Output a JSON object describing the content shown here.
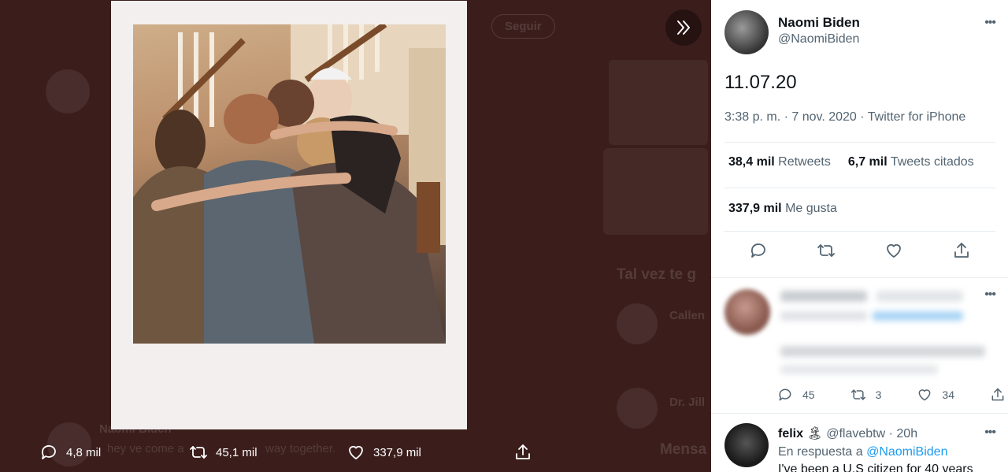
{
  "media_view": {
    "background_text": {
      "follow_button": "Seguir",
      "suggestions_heading": "Tal vez te g",
      "suggestion_1": "Callen",
      "suggestion_2": "Dr. Jill",
      "messages_label": "Mensa",
      "bg_author": "Naomi Biden",
      "bg_tweet_text": "hey ve come a",
      "bg_tweet_text_2": "way together."
    },
    "actions": {
      "replies": "4,8 mil",
      "retweets": "45,1 mil",
      "likes": "337,9 mil"
    }
  },
  "tweet": {
    "author_name": "Naomi Biden",
    "author_handle": "@NaomiBiden",
    "text": "11.07.20",
    "time": "3:38 p. m.",
    "date": "7 nov. 2020",
    "source": "Twitter for iPhone",
    "stats": {
      "retweets_value": "38,4 mil",
      "retweets_label": "Retweets",
      "quotes_value": "6,7 mil",
      "quotes_label": "Tweets citados",
      "likes_value": "337,9 mil",
      "likes_label": "Me gusta"
    }
  },
  "replies": [
    {
      "blurred": true,
      "replies": "45",
      "retweets": "3",
      "likes": "34"
    },
    {
      "name": "felix",
      "emoji": "🏝",
      "handle": "@flavebtw",
      "age": "20h",
      "reply_prefix": "En respuesta a",
      "reply_to": "@NaomiBiden",
      "text": "I've been a U.S citizen for 40 years"
    }
  ],
  "icons": {
    "next": "chevron-double-right-icon",
    "reply": "reply-icon",
    "retweet": "retweet-icon",
    "like": "heart-icon",
    "share": "share-icon",
    "more": "more-icon"
  },
  "colors": {
    "overlay": "#3b1e1c",
    "link": "#1d9bf0",
    "secondary_text": "#536471"
  }
}
